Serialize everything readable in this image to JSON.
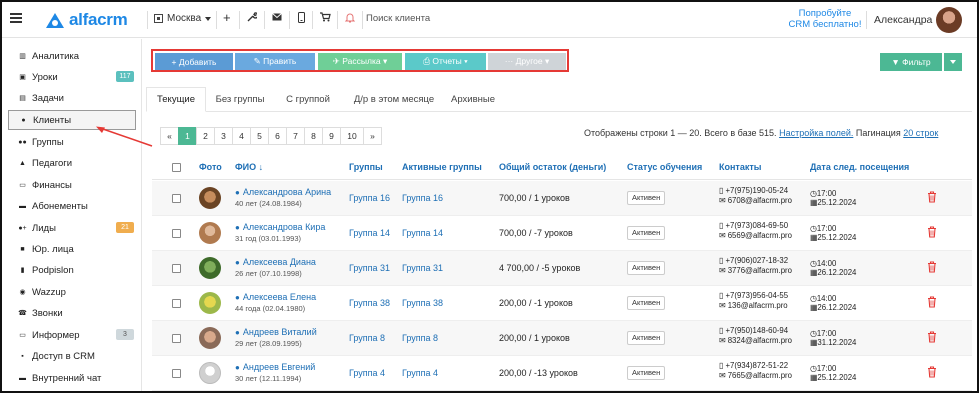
{
  "app": {
    "logo_text": "alfacrm",
    "branch": "Москва",
    "search_placeholder": "Поиск клиента",
    "promo_line1": "Попробуйте",
    "promo_line2": "CRM бесплатно!",
    "user_name": "Александра",
    "accent": "#1e88e5"
  },
  "sidebar": {
    "items": [
      {
        "label": "Аналитика",
        "icon": "chart-icon"
      },
      {
        "label": "Уроки",
        "icon": "calendar-icon",
        "badge": "117"
      },
      {
        "label": "Задачи",
        "icon": "clipboard-icon"
      },
      {
        "label": "Клиенты",
        "icon": "user-icon"
      },
      {
        "label": "Группы",
        "icon": "users-icon"
      },
      {
        "label": "Педагоги",
        "icon": "graduation-cap-icon"
      },
      {
        "label": "Финансы",
        "icon": "money-icon"
      },
      {
        "label": "Абонементы",
        "icon": "ticket-icon"
      },
      {
        "label": "Лиды",
        "icon": "user-plus-icon",
        "badge": "21"
      },
      {
        "label": "Юр. лица",
        "icon": "briefcase-icon"
      },
      {
        "label": "Podpislon",
        "icon": "document-icon"
      },
      {
        "label": "Wazzup",
        "icon": "whatsapp-icon"
      },
      {
        "label": "Звонки",
        "icon": "phone-icon"
      },
      {
        "label": "Информер",
        "icon": "inbox-icon",
        "badge": "3"
      },
      {
        "label": "Доступ в CRM",
        "icon": "lock-icon"
      },
      {
        "label": "Внутренний чат",
        "icon": "chat-icon"
      }
    ]
  },
  "toolbar": {
    "add": "+ Добавить",
    "edit": "✎ Править",
    "mailing": "✈ Рассылка ▾",
    "reports": "⎙ Отчеты ▾",
    "other": "··· Другое ▾",
    "filter": "▼ Фильтр"
  },
  "tabs": [
    "Текущие",
    "Без группы",
    "С группой",
    "Д/р в этом месяце",
    "Архивные"
  ],
  "pagination": {
    "prev": "«",
    "pages": [
      "1",
      "2",
      "3",
      "4",
      "5",
      "6",
      "7",
      "8",
      "9",
      "10"
    ],
    "next": "»",
    "current": "1"
  },
  "info": {
    "text": "Отображены строки 1 — 20. Всего в базе 515.",
    "columns_link": "Настройка полей.",
    "pagination_label": "Пагинация",
    "pagination_link": "20 строк"
  },
  "table": {
    "headers": {
      "photo": "Фото",
      "fio": "ФИО ↓",
      "groups": "Группы",
      "active_groups": "Активные группы",
      "balance": "Общий остаток (деньги)",
      "status": "Статус обучения",
      "contacts": "Контакты",
      "next_visit": "Дата след. посещения"
    },
    "rows": [
      {
        "name": "Александрова Арина",
        "age": "40 лет (24.08.1984)",
        "group": "Группа 16",
        "active_group": "Группа 16",
        "balance": "700,00 / 1 уроков",
        "status": "Активен",
        "phone": "+7(975)190-05-24",
        "email": "6708@alfacrm.pro",
        "time": "17:00",
        "date": "25.12.2024"
      },
      {
        "name": "Александрова Кира",
        "age": "31 год (03.01.1993)",
        "group": "Группа 14",
        "active_group": "Группа 14",
        "balance": "700,00 / -7 уроков",
        "status": "Активен",
        "phone": "+7(973)084-69-50",
        "email": "6569@alfacrm.pro",
        "time": "17:00",
        "date": "25.12.2024"
      },
      {
        "name": "Алексеева Диана",
        "age": "26 лет (07.10.1998)",
        "group": "Группа 31",
        "active_group": "Группа 31",
        "balance": "4 700,00 / -5 уроков",
        "status": "Активен",
        "phone": "+7(906)027-18-32",
        "email": "3776@alfacrm.pro",
        "time": "14:00",
        "date": "26.12.2024"
      },
      {
        "name": "Алексеева Елена",
        "age": "44 года (02.04.1980)",
        "group": "Группа 38",
        "active_group": "Группа 38",
        "balance": "200,00 / -1 уроков",
        "status": "Активен",
        "phone": "+7(973)956-04-55",
        "email": "136@alfacrm.pro",
        "time": "14:00",
        "date": "26.12.2024"
      },
      {
        "name": "Андреев Виталий",
        "age": "29 лет (28.09.1995)",
        "group": "Группа 8",
        "active_group": "Группа 8",
        "balance": "200,00 / 1 уроков",
        "status": "Активен",
        "phone": "+7(950)148-60-94",
        "email": "8324@alfacrm.pro",
        "time": "17:00",
        "date": "31.12.2024"
      },
      {
        "name": "Андреев Евгений",
        "age": "30 лет (12.11.1994)",
        "group": "Группа 4",
        "active_group": "Группа 4",
        "balance": "200,00 / -13 уроков",
        "status": "Активен",
        "phone": "+7(934)872-51-22",
        "email": "7665@alfacrm.pro",
        "time": "17:00",
        "date": "25.12.2024"
      }
    ]
  }
}
